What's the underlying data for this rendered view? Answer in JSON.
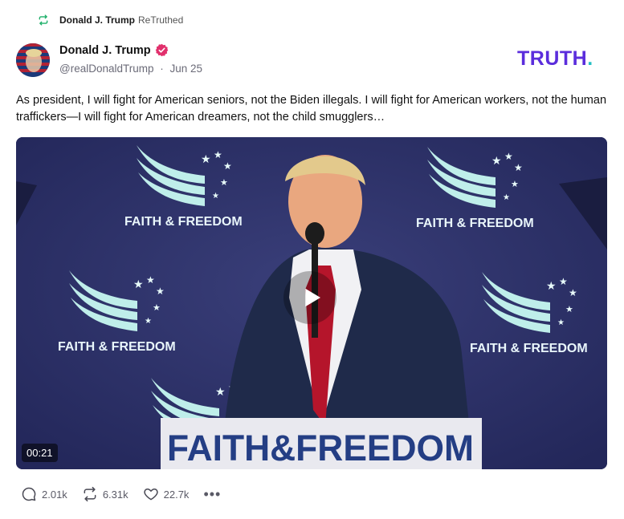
{
  "retruth": {
    "author": "Donald J. Trump",
    "label": "ReTruthed",
    "icon": "retruth-icon"
  },
  "post": {
    "author_name": "Donald J. Trump",
    "handle": "@realDonaldTrump",
    "separator": "·",
    "date": "Jun 25",
    "text": "As president, I will fight for American seniors, not the Biden illegals. I will fight for American workers, not the human traffickers—I will fight for American dreamers, not the child smugglers…"
  },
  "brand": {
    "name": "TRUTH",
    "dot": ".",
    "color": "#5b2ddc",
    "dot_color": "#24c0c4"
  },
  "video": {
    "duration": "00:21",
    "banner_text": "FAITH&FREEDOM",
    "backdrop_logo_faith": "FAITH",
    "backdrop_logo_amp": "&",
    "backdrop_logo_freedom": "FREEDOM"
  },
  "actions": {
    "replies": "2.01k",
    "retruths": "6.31k",
    "likes": "22.7k",
    "more": "•••"
  },
  "colors": {
    "verified": "#e1306c",
    "backdrop": "#2b2f63",
    "accent_teal": "#9fe3e0"
  }
}
